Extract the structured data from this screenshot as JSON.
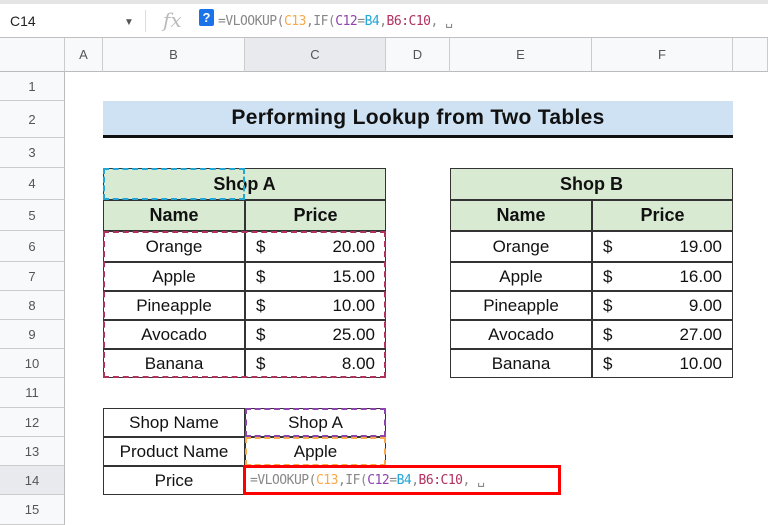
{
  "formula_bar": {
    "cell_ref": "C14",
    "help_label": "?",
    "formula_parts": [
      {
        "text": "=VLOOKUP(",
        "color": "#888888"
      },
      {
        "text": "C13",
        "color": "#f9a94b"
      },
      {
        "text": ",IF(",
        "color": "#888888"
      },
      {
        "text": "C12",
        "color": "#8e44ad"
      },
      {
        "text": "=",
        "color": "#888888"
      },
      {
        "text": "B4",
        "color": "#22a6d6"
      },
      {
        "text": ",",
        "color": "#888888"
      },
      {
        "text": "B6:C10",
        "color": "#b0305e"
      },
      {
        "text": ", ␣",
        "color": "#888888"
      }
    ]
  },
  "columns": [
    "A",
    "B",
    "C",
    "D",
    "E",
    "F",
    ""
  ],
  "selected_column": "C",
  "rows": [
    "1",
    "2",
    "3",
    "4",
    "5",
    "6",
    "7",
    "8",
    "9",
    "10",
    "11",
    "12",
    "13",
    "14",
    "15"
  ],
  "selected_row": "14",
  "title": "Performing Lookup from Two Tables",
  "shop_a": {
    "title": "Shop A",
    "headers": [
      "Name",
      "Price"
    ],
    "items": [
      {
        "name": "Orange",
        "cur": "$",
        "price": "20.00"
      },
      {
        "name": "Apple",
        "cur": "$",
        "price": "15.00"
      },
      {
        "name": "Pineapple",
        "cur": "$",
        "price": "10.00"
      },
      {
        "name": "Avocado",
        "cur": "$",
        "price": "25.00"
      },
      {
        "name": "Banana",
        "cur": "$",
        "price": "8.00"
      }
    ]
  },
  "shop_b": {
    "title": "Shop B",
    "headers": [
      "Name",
      "Price"
    ],
    "items": [
      {
        "name": "Orange",
        "cur": "$",
        "price": "19.00"
      },
      {
        "name": "Apple",
        "cur": "$",
        "price": "16.00"
      },
      {
        "name": "Pineapple",
        "cur": "$",
        "price": "9.00"
      },
      {
        "name": "Avocado",
        "cur": "$",
        "price": "27.00"
      },
      {
        "name": "Banana",
        "cur": "$",
        "price": "10.00"
      }
    ]
  },
  "lookup": [
    {
      "label": "Shop Name",
      "value": "Shop A"
    },
    {
      "label": "Product Name",
      "value": "Apple"
    },
    {
      "label": "Price",
      "value": ""
    }
  ],
  "colors": {
    "active_edit_border": "#ff0000",
    "ref_b4": "#22a6d6",
    "ref_b6c10": "#b0305e",
    "ref_c12": "#8e44ad",
    "ref_c13": "#f9a94b"
  }
}
